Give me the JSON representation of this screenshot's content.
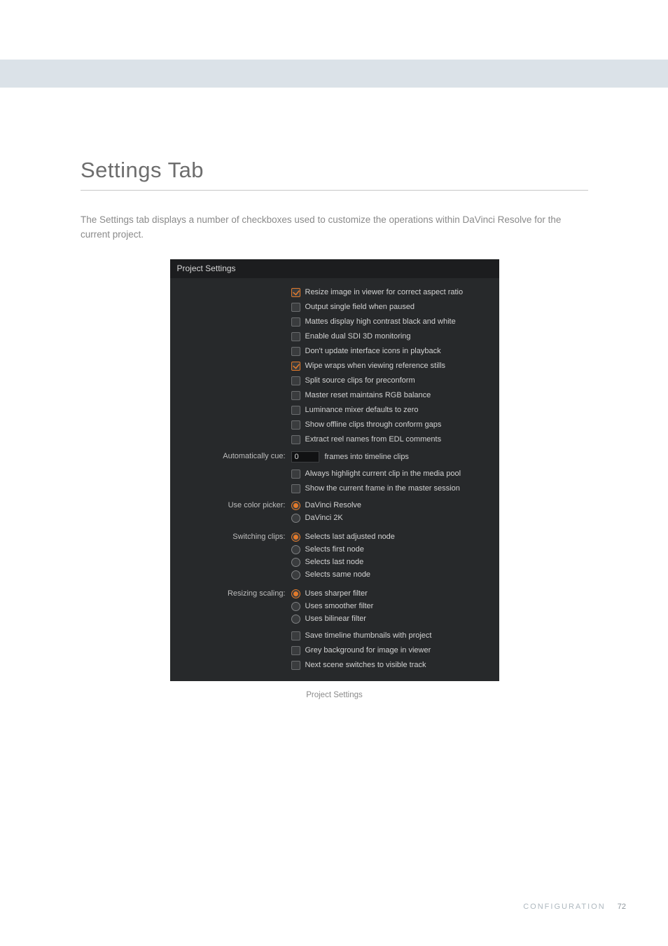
{
  "heading": "Settings Tab",
  "intro": "The Settings tab displays a number of checkboxes used to customize the operations within DaVinci Resolve for the current project.",
  "panel_title": "Project Settings",
  "checkboxes_top": [
    {
      "checked": true,
      "label": "Resize image in viewer for correct aspect ratio"
    },
    {
      "checked": false,
      "label": "Output single field when paused"
    },
    {
      "checked": false,
      "label": "Mattes display high contrast black and white"
    },
    {
      "checked": false,
      "label": "Enable dual SDI 3D monitoring"
    },
    {
      "checked": false,
      "label": "Don't update interface icons in playback"
    },
    {
      "checked": true,
      "label": "Wipe wraps when viewing reference stills"
    },
    {
      "checked": false,
      "label": "Split source clips for preconform"
    },
    {
      "checked": false,
      "label": "Master reset maintains RGB balance"
    },
    {
      "checked": false,
      "label": "Luminance mixer defaults to zero"
    },
    {
      "checked": false,
      "label": "Show offline clips through conform gaps"
    },
    {
      "checked": false,
      "label": "Extract reel names from EDL comments"
    }
  ],
  "auto_cue_label": "Automatically cue:",
  "auto_cue_value": "0",
  "auto_cue_suffix": "frames into timeline clips",
  "checkboxes_mid": [
    {
      "checked": false,
      "label": "Always highlight current clip in the media pool"
    },
    {
      "checked": false,
      "label": "Show the current frame in the master session"
    }
  ],
  "color_picker_label": "Use color picker:",
  "color_picker_options": [
    {
      "selected": true,
      "label": "DaVinci Resolve"
    },
    {
      "selected": false,
      "label": "DaVinci 2K"
    }
  ],
  "switching_label": "Switching clips:",
  "switching_options": [
    {
      "selected": true,
      "label": "Selects last adjusted node"
    },
    {
      "selected": false,
      "label": "Selects first node"
    },
    {
      "selected": false,
      "label": "Selects last node"
    },
    {
      "selected": false,
      "label": "Selects same node"
    }
  ],
  "resizing_label": "Resizing scaling:",
  "resizing_options": [
    {
      "selected": true,
      "label": "Uses sharper filter"
    },
    {
      "selected": false,
      "label": "Uses smoother filter"
    },
    {
      "selected": false,
      "label": "Uses bilinear filter"
    }
  ],
  "checkboxes_bottom": [
    {
      "checked": false,
      "label": "Save timeline thumbnails with project"
    },
    {
      "checked": false,
      "label": "Grey background for image in viewer"
    },
    {
      "checked": false,
      "label": "Next scene switches to visible track"
    }
  ],
  "caption": "Project Settings",
  "footer_section": "CONFIGURATION",
  "footer_page": "72"
}
